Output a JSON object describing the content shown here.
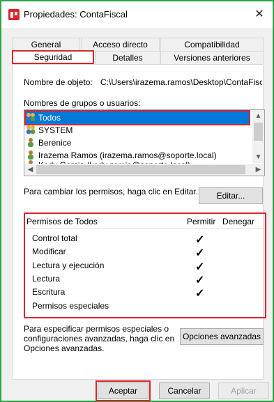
{
  "window": {
    "title": "Propiedades: ContaFiscal",
    "close_glyph": "✕"
  },
  "tabs": {
    "row1": [
      "General",
      "Acceso directo",
      "Compatibilidad"
    ],
    "row2": [
      "Seguridad",
      "Detalles",
      "Versiones anteriores"
    ]
  },
  "object": {
    "label": "Nombre de objeto:",
    "value": "C:\\Users\\irazema.ramos\\Desktop\\ContaFisca"
  },
  "groups": {
    "label": "Nombres de grupos o usuarios:",
    "users": [
      {
        "name": "Todos",
        "icon": "group-icon",
        "selected": true
      },
      {
        "name": "SYSTEM",
        "icon": "group-icon",
        "selected": false
      },
      {
        "name": "Berenice",
        "icon": "user-icon",
        "selected": false
      },
      {
        "name": "Irazema Ramos (irazema.ramos@soporte.local)",
        "icon": "user-icon",
        "selected": false
      },
      {
        "name": "Kody Garcia (kody.garcia@soporte.local)",
        "icon": "user-icon",
        "selected": false
      }
    ]
  },
  "permissions": {
    "instruct": "Para cambiar los permisos, haga clic en Editar.",
    "edit_label": "Editar...",
    "header_title": "Permisos de Todos",
    "header_allow": "Permitir",
    "header_deny": "Denegar",
    "rows": [
      {
        "name": "Control total",
        "allow": "✓",
        "deny": ""
      },
      {
        "name": "Modificar",
        "allow": "✓",
        "deny": ""
      },
      {
        "name": "Lectura y ejecución",
        "allow": "✓",
        "deny": ""
      },
      {
        "name": "Lectura",
        "allow": "✓",
        "deny": ""
      },
      {
        "name": "Escritura",
        "allow": "✓",
        "deny": ""
      },
      {
        "name": "Permisos especiales",
        "allow": "",
        "deny": ""
      }
    ]
  },
  "special": {
    "instruct": "Para especificar permisos especiales o configuraciones avanzadas, haga clic en Opciones avanzadas.",
    "button": "Opciones avanzadas"
  },
  "footer": {
    "ok": "Aceptar",
    "cancel": "Cancelar",
    "apply": "Aplicar"
  },
  "colors": {
    "highlight": "#d9252b",
    "selection": "#0078d7",
    "frame": "#28a745"
  }
}
